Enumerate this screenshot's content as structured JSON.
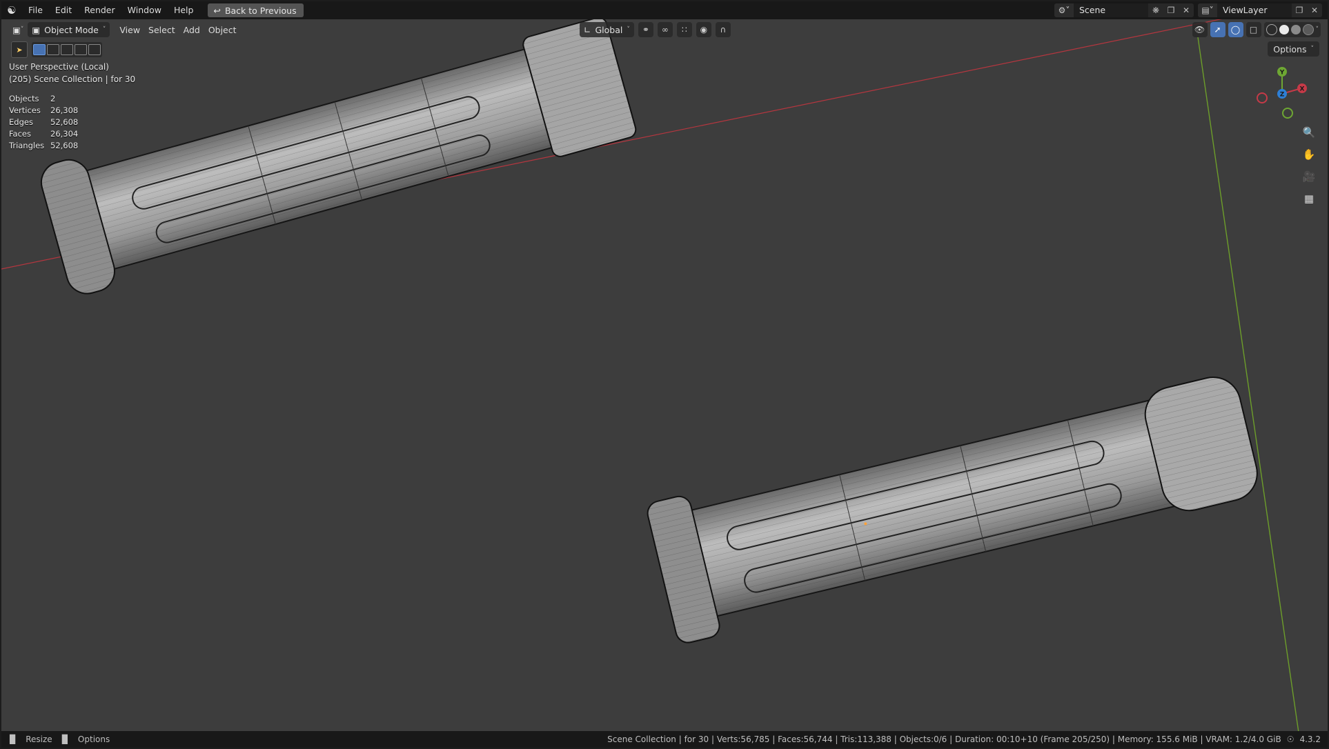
{
  "topbar": {
    "menu": [
      "File",
      "Edit",
      "Render",
      "Window",
      "Help"
    ],
    "back_button": "Back to Previous",
    "scene_name": "Scene",
    "view_layer": "ViewLayer"
  },
  "header": {
    "mode": "Object Mode",
    "menus": [
      "View",
      "Select",
      "Add",
      "Object"
    ],
    "orientation": "Global",
    "options_label": "Options"
  },
  "viewport": {
    "perspective": "User Perspective (Local)",
    "collection": "(205) Scene Collection | for 30",
    "stats": [
      {
        "label": "Objects",
        "value": "2"
      },
      {
        "label": "Vertices",
        "value": "26,308"
      },
      {
        "label": "Edges",
        "value": "52,608"
      },
      {
        "label": "Faces",
        "value": "26,304"
      },
      {
        "label": "Triangles",
        "value": "52,608"
      }
    ],
    "gizmo": {
      "x": "X",
      "y": "Y",
      "z": "Z"
    },
    "axis_colors": {
      "x": "#c63a48",
      "y": "#6ea733",
      "z": "#2d7fd6"
    }
  },
  "statusbar": {
    "left": [
      "Resize",
      "Options"
    ],
    "info": "Scene Collection | for 30 | Verts:56,785 | Faces:56,744 | Tris:113,388 | Objects:0/6 | Duration: 00:10+10 (Frame 205/250) | Memory: 155.6 MiB | VRAM: 1.2/4.0 GiB",
    "version": "4.3.2"
  }
}
